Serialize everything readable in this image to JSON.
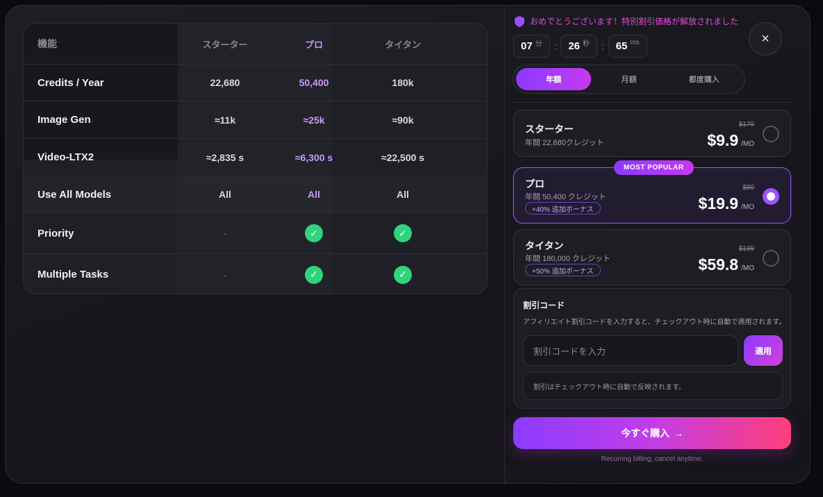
{
  "table": {
    "header": {
      "feature": "機能",
      "plans": [
        "スターター",
        "プロ",
        "タイタン"
      ]
    },
    "rows": [
      {
        "label": "Credits / Year",
        "values": [
          "22,680",
          "50,400",
          "180k"
        ]
      },
      {
        "label": "Image Gen",
        "values": [
          "≈11k",
          "≈25k",
          "≈90k"
        ]
      },
      {
        "label": "Video-LTX2",
        "values": [
          "≈2,835 s",
          "≈6,300 s",
          "≈22,500 s"
        ]
      },
      {
        "label": "Use All Models",
        "values": [
          "All",
          "All",
          "All"
        ]
      },
      {
        "label": "Priority",
        "values": [
          "-",
          "check",
          "check"
        ]
      },
      {
        "label": "Multiple Tasks",
        "values": [
          "-",
          "check",
          "check"
        ]
      }
    ]
  },
  "promo": {
    "message": "おめでとうございます！特別割引価格が解放されました",
    "timer": [
      {
        "value": "07",
        "unit": "分"
      },
      {
        "value": "26",
        "unit": "秒"
      },
      {
        "value": "65",
        "unit": "ms"
      }
    ],
    "separator": ":"
  },
  "close_icon": "×",
  "billing_tabs": [
    {
      "label": "年額",
      "active": true
    },
    {
      "label": "月額",
      "active": false
    },
    {
      "label": "都度購入",
      "active": false
    }
  ],
  "plans": [
    {
      "name": "スターター",
      "sub": "年間 22,680クレジット",
      "bonus": "",
      "old_price": "$179",
      "price": "$9.9",
      "per": "/MO",
      "selected": false
    },
    {
      "name": "プロ",
      "sub": "年間 50,400 クレジット",
      "bonus": "+40% 追加ボーナス",
      "old_price": "$80",
      "price": "$19.9",
      "per": "/MO",
      "selected": true
    },
    {
      "name": "タイタン",
      "sub": "年間 180,000 クレジット",
      "bonus": "+50% 追加ボーナス",
      "old_price": "$199",
      "price": "$59.8",
      "per": "/MO",
      "selected": false
    }
  ],
  "popular_badge": "MOST POPULAR",
  "coupon": {
    "title": "割引コード",
    "description": "アフィリエイト割引コードを入力すると、チェックアウト時に自動で適用されます。",
    "placeholder": "割引コードを入力",
    "apply_label": "適用",
    "note": "割引はチェックアウト時に自動で反映されます。"
  },
  "buy": {
    "label": "今すぐ購入",
    "arrow": "→"
  },
  "footer": "Recurring billing, cancel anytime.",
  "colors": {
    "accent": "#8a3bff",
    "accent2": "#c639f0",
    "pink": "#ff3f7a",
    "check": "#2fd57c",
    "promo_text": "#e34bd3"
  }
}
